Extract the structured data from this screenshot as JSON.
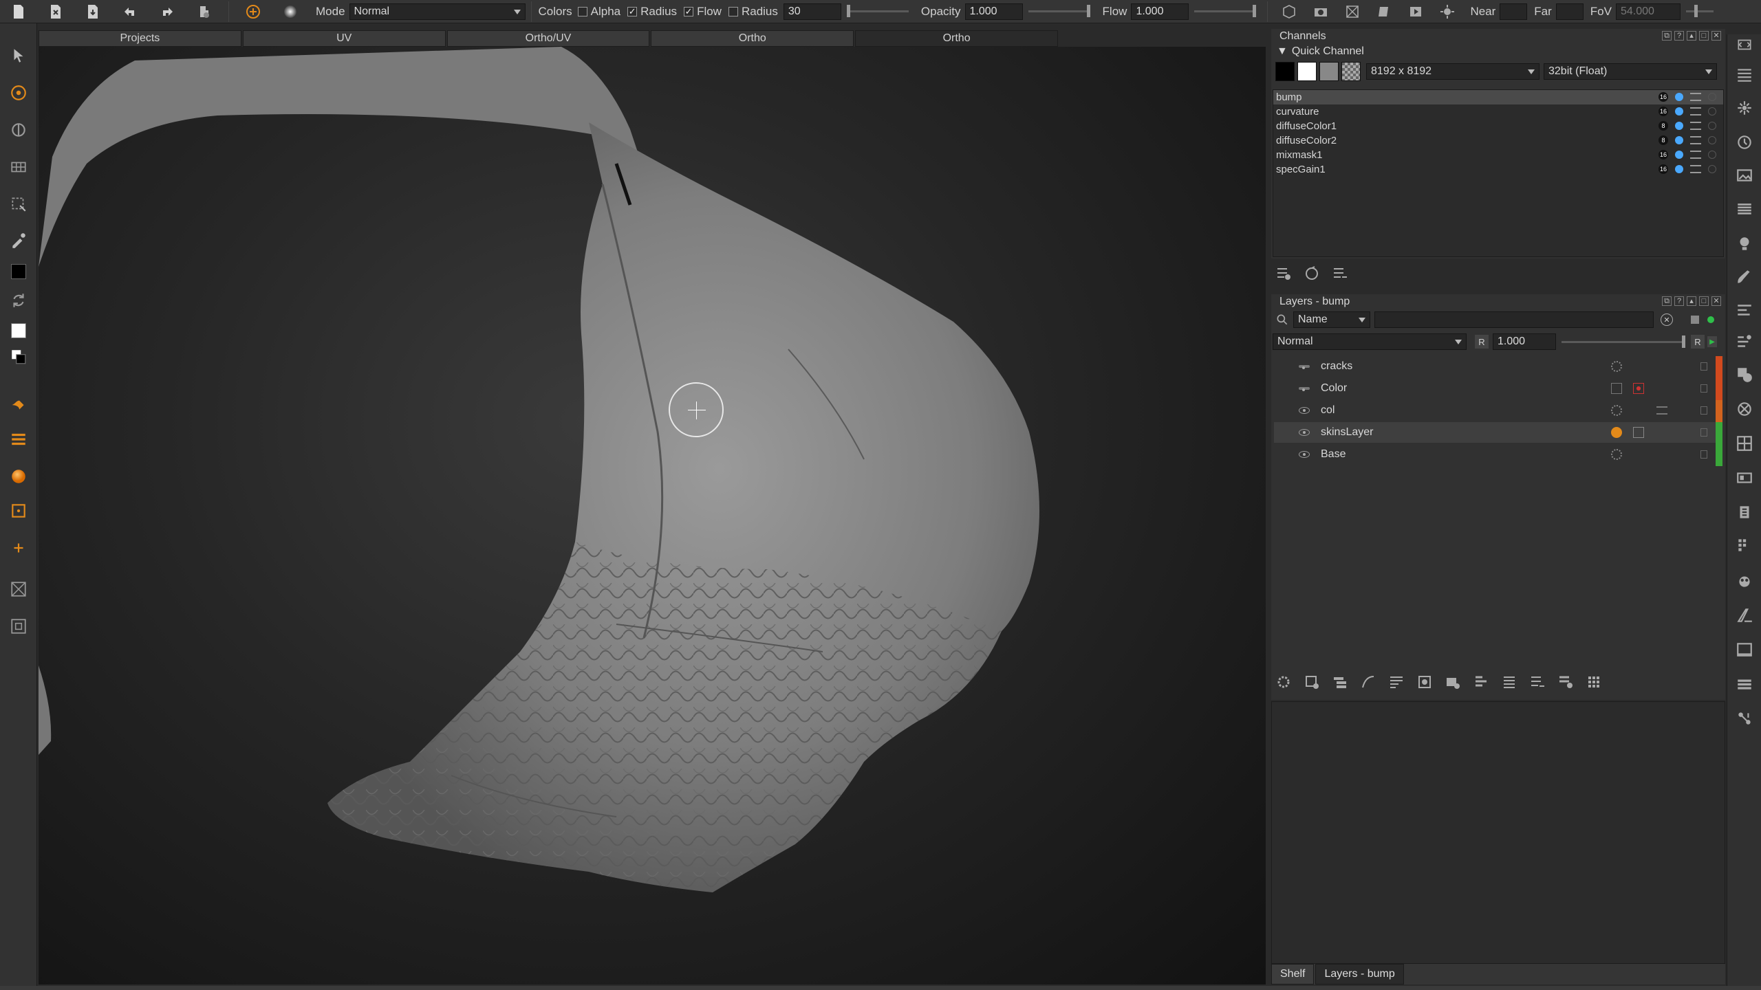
{
  "toolbar": {
    "mode_label": "Mode",
    "mode_value": "Normal",
    "colors_label": "Colors",
    "alpha_label": "Alpha",
    "alpha_checked": false,
    "radius_check_label": "Radius",
    "radius_checked": true,
    "flow_check_label": "Flow",
    "flow_checked": true,
    "radius_label": "Radius",
    "radius_value": "30",
    "opacity_label": "Opacity",
    "opacity_value": "1.000",
    "flow_label": "Flow",
    "flow_value": "1.000",
    "near_label": "Near",
    "far_label": "Far",
    "fov_label": "FoV",
    "fov_value": "54.000"
  },
  "viewport_tabs": [
    "Projects",
    "UV",
    "Ortho/UV",
    "Ortho",
    "Ortho"
  ],
  "viewport_active_tab": 4,
  "channels": {
    "title": "Channels",
    "quick_channel": "Quick Channel",
    "resolution": "8192 x 8192",
    "depth": "32bit (Float)",
    "items": [
      {
        "name": "bump",
        "depth": "16",
        "selected": true
      },
      {
        "name": "curvature",
        "depth": "16",
        "selected": false
      },
      {
        "name": "diffuseColor1",
        "depth": "8",
        "selected": false
      },
      {
        "name": "diffuseColor2",
        "depth": "8",
        "selected": false
      },
      {
        "name": "mixmask1",
        "depth": "16",
        "selected": false
      },
      {
        "name": "specGain1",
        "depth": "16",
        "selected": false
      }
    ]
  },
  "layers": {
    "title": "Layers - bump",
    "filter_label": "Name",
    "blend_mode": "Normal",
    "opacity_flag": "R",
    "opacity_value": "1.000",
    "lock_flag": "R",
    "items": [
      {
        "name": "cracks",
        "color": "#d24a1e",
        "selected": false
      },
      {
        "name": "Color",
        "color": "#d24a1e",
        "selected": false
      },
      {
        "name": "col",
        "color": "#d2631e",
        "selected": false
      },
      {
        "name": "skinsLayer",
        "color": "#3aa83a",
        "selected": true
      },
      {
        "name": "Base",
        "color": "#3aa83a",
        "selected": false
      }
    ]
  },
  "bottom_tabs": [
    "Shelf",
    "Layers - bump"
  ],
  "bottom_active_tab": 1
}
